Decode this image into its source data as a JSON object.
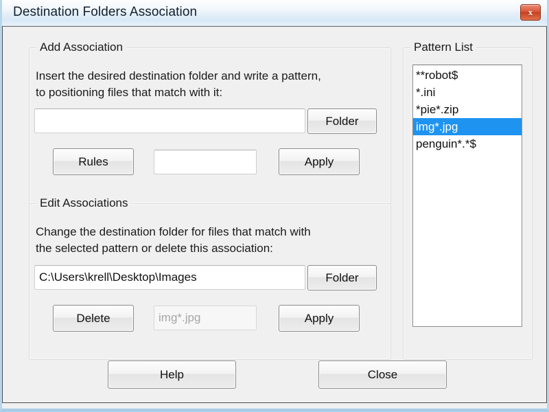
{
  "window": {
    "title": "Destination Folders Association",
    "close_icon": "close-icon",
    "close_label": "x"
  },
  "add_association": {
    "legend": "Add Association",
    "description": "Insert the desired destination folder and write a pattern,\nto positioning files that match with it:",
    "folder_value": "",
    "folder_placeholder": "",
    "folder_button": "Folder",
    "rules_button": "Rules",
    "pattern_value": "",
    "pattern_placeholder": "",
    "apply_button": "Apply"
  },
  "edit_associations": {
    "legend": "Edit Associations",
    "description": "Change the destination folder for files that match with\nthe selected pattern or delete this association:",
    "folder_value": "C:\\Users\\krell\\Desktop\\Images",
    "folder_button": "Folder",
    "delete_button": "Delete",
    "pattern_value": "",
    "pattern_placeholder": "img*.jpg",
    "apply_button": "Apply"
  },
  "pattern_list": {
    "legend": "Pattern List",
    "items": [
      {
        "text": "**robot$",
        "selected": false
      },
      {
        "text": "*.ini",
        "selected": false
      },
      {
        "text": "*pie*.zip",
        "selected": false
      },
      {
        "text": "img*.jpg",
        "selected": true
      },
      {
        "text": "penguin*.*$",
        "selected": false
      }
    ]
  },
  "footer": {
    "help_button": "Help",
    "close_button": "Close"
  },
  "colors": {
    "selection_blue": "#1f93f0",
    "dialog_background": "#f0f0f0",
    "close_button_red": "#d9563a"
  }
}
